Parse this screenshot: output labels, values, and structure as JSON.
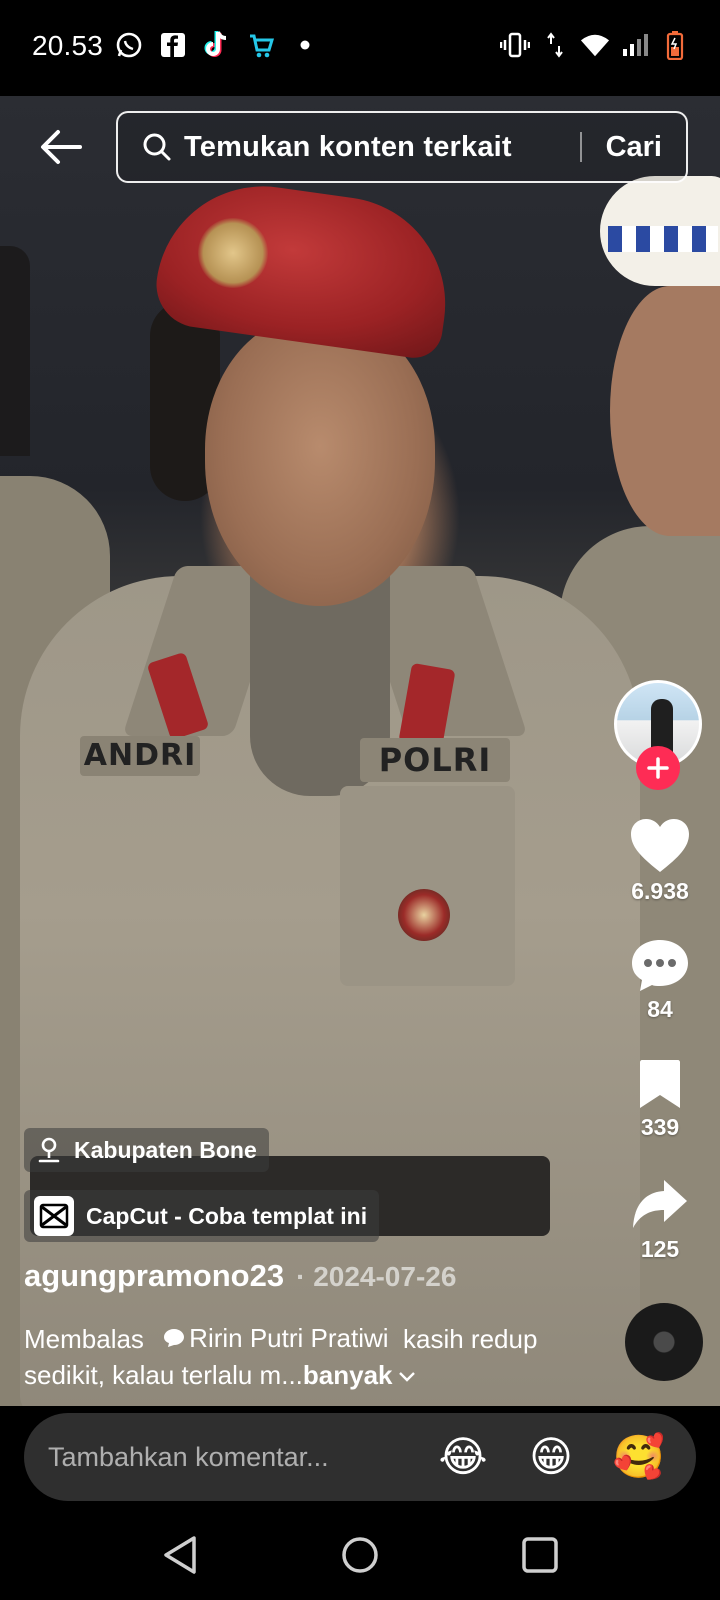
{
  "status_bar": {
    "time": "20.53",
    "left_icons": [
      "whatsapp-icon",
      "facebook-icon",
      "tiktok-icon",
      "shop-icon",
      "dot-icon"
    ],
    "right_icons": [
      "vibrate-icon",
      "data-arrows-icon",
      "wifi-icon",
      "signal-icon",
      "battery-icon"
    ]
  },
  "search": {
    "placeholder": "Temukan konten terkait",
    "button_label": "Cari"
  },
  "video_text": {
    "nametag": "ANDRI",
    "chest_tag": "POLRI"
  },
  "actions": {
    "likes": "6.938",
    "comments": "84",
    "saves": "339",
    "shares": "125"
  },
  "location": {
    "label": "Kabupaten Bone"
  },
  "template": {
    "label": "CapCut - Coba templat ini"
  },
  "post": {
    "author": "agungpramono23",
    "date": "· 2024-07-26",
    "reply_prefix": "Membalas",
    "reply_user": "Ririn Putri Pratiwi",
    "caption_text": "kasih redup sedikit, kalau terlalu m...",
    "more_label": "banyak"
  },
  "comment_bar": {
    "placeholder": "Tambahkan komentar...",
    "emojis": [
      "😂",
      "😁",
      "🥰"
    ]
  },
  "colors": {
    "accent": "#fe2c55",
    "comment_bg": "#2f2f2f"
  }
}
